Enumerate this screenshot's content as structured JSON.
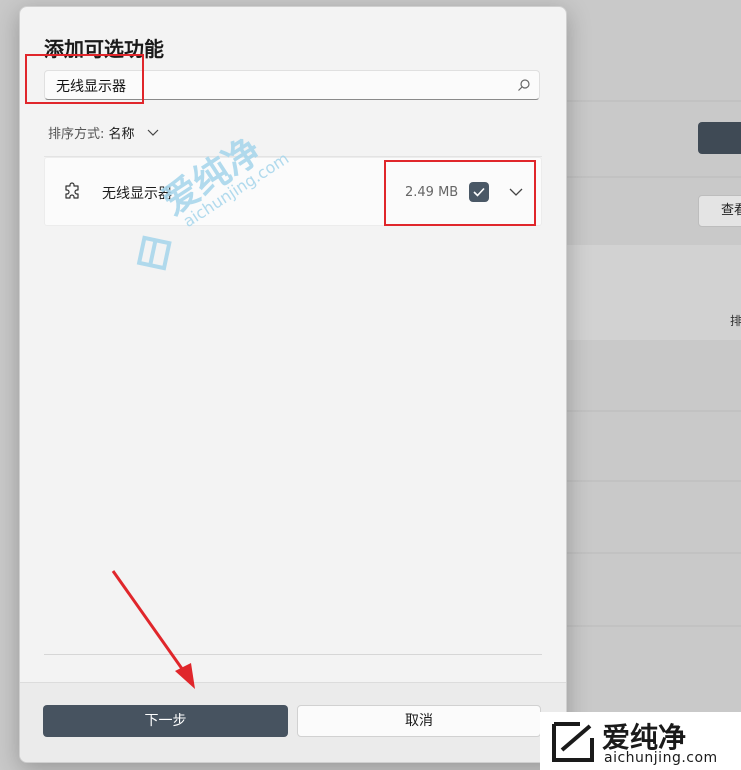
{
  "dialog": {
    "title": "添加可选功能",
    "search": {
      "value": "无线显示器"
    },
    "sort": {
      "label": "排序方式:",
      "value": "名称"
    },
    "items": [
      {
        "name": "无线显示器",
        "size": "2.49 MB",
        "checked": true
      }
    ],
    "buttons": {
      "next": "下一步",
      "cancel": "取消"
    }
  },
  "background": {
    "button_label": "查看",
    "sort_label": "排"
  },
  "watermark": {
    "cn": "爱纯净",
    "en": "aichunjing.com"
  },
  "colors": {
    "highlight": "#e0262b",
    "primary_button": "#475360",
    "checkbox": "#4a5866",
    "watermark": "#a9d7ec"
  }
}
